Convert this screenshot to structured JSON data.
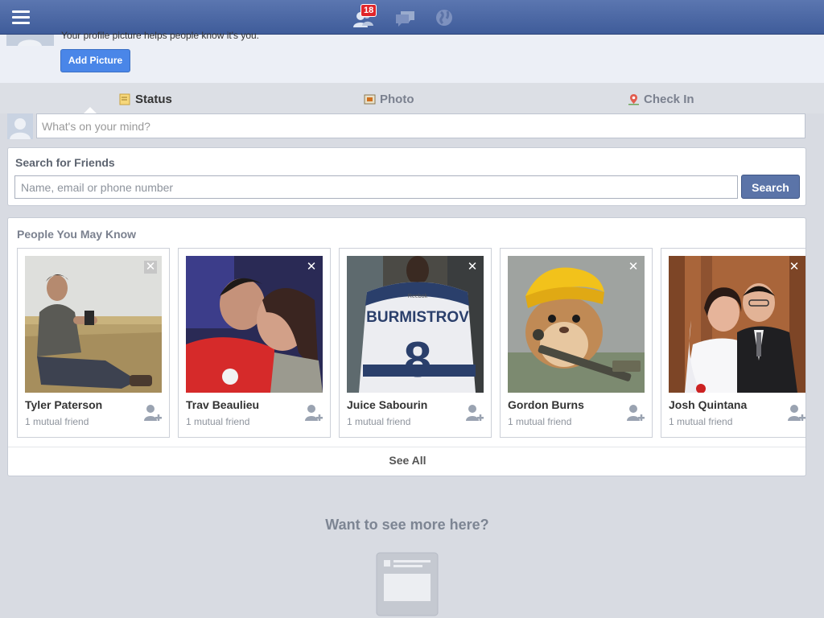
{
  "topbar": {
    "friend_requests_badge": "18",
    "icons": [
      "menu-icon",
      "friend-requests-icon",
      "messages-icon",
      "notifications-globe-icon"
    ]
  },
  "banner": {
    "text": "Your profile picture helps people know it's you.",
    "add_picture_label": "Add Picture"
  },
  "composer": {
    "tabs": [
      {
        "label": "Status",
        "icon": "status-note-icon"
      },
      {
        "label": "Photo",
        "icon": "photo-icon"
      },
      {
        "label": "Check In",
        "icon": "map-pin-icon"
      }
    ],
    "placeholder": "What's on your mind?"
  },
  "search_friends": {
    "title": "Search for Friends",
    "placeholder": "Name, email or phone number",
    "button_label": "Search"
  },
  "pymk": {
    "title": "People You May Know",
    "people": [
      {
        "name": "Tyler Paterson",
        "mutual": "1 mutual friend"
      },
      {
        "name": "Trav Beaulieu",
        "mutual": "1 mutual friend"
      },
      {
        "name": "Juice Sabourin",
        "mutual": "1 mutual friend",
        "jersey_name": "BURMISTROV",
        "jersey_number": "8",
        "jersey_brand": "Reebok"
      },
      {
        "name": "Gordon Burns",
        "mutual": "1 mutual friend"
      },
      {
        "name": "Josh Quintana",
        "mutual": "1 mutual friend"
      }
    ],
    "dismiss_symbol": "✕",
    "see_all_label": "See All"
  },
  "more": {
    "title": "Want to see more here?"
  },
  "colors": {
    "topbar": "#4a65a3",
    "add_picture_button": "#4a86e8",
    "search_button": "#5b74a8",
    "badge": "#e0252a"
  }
}
